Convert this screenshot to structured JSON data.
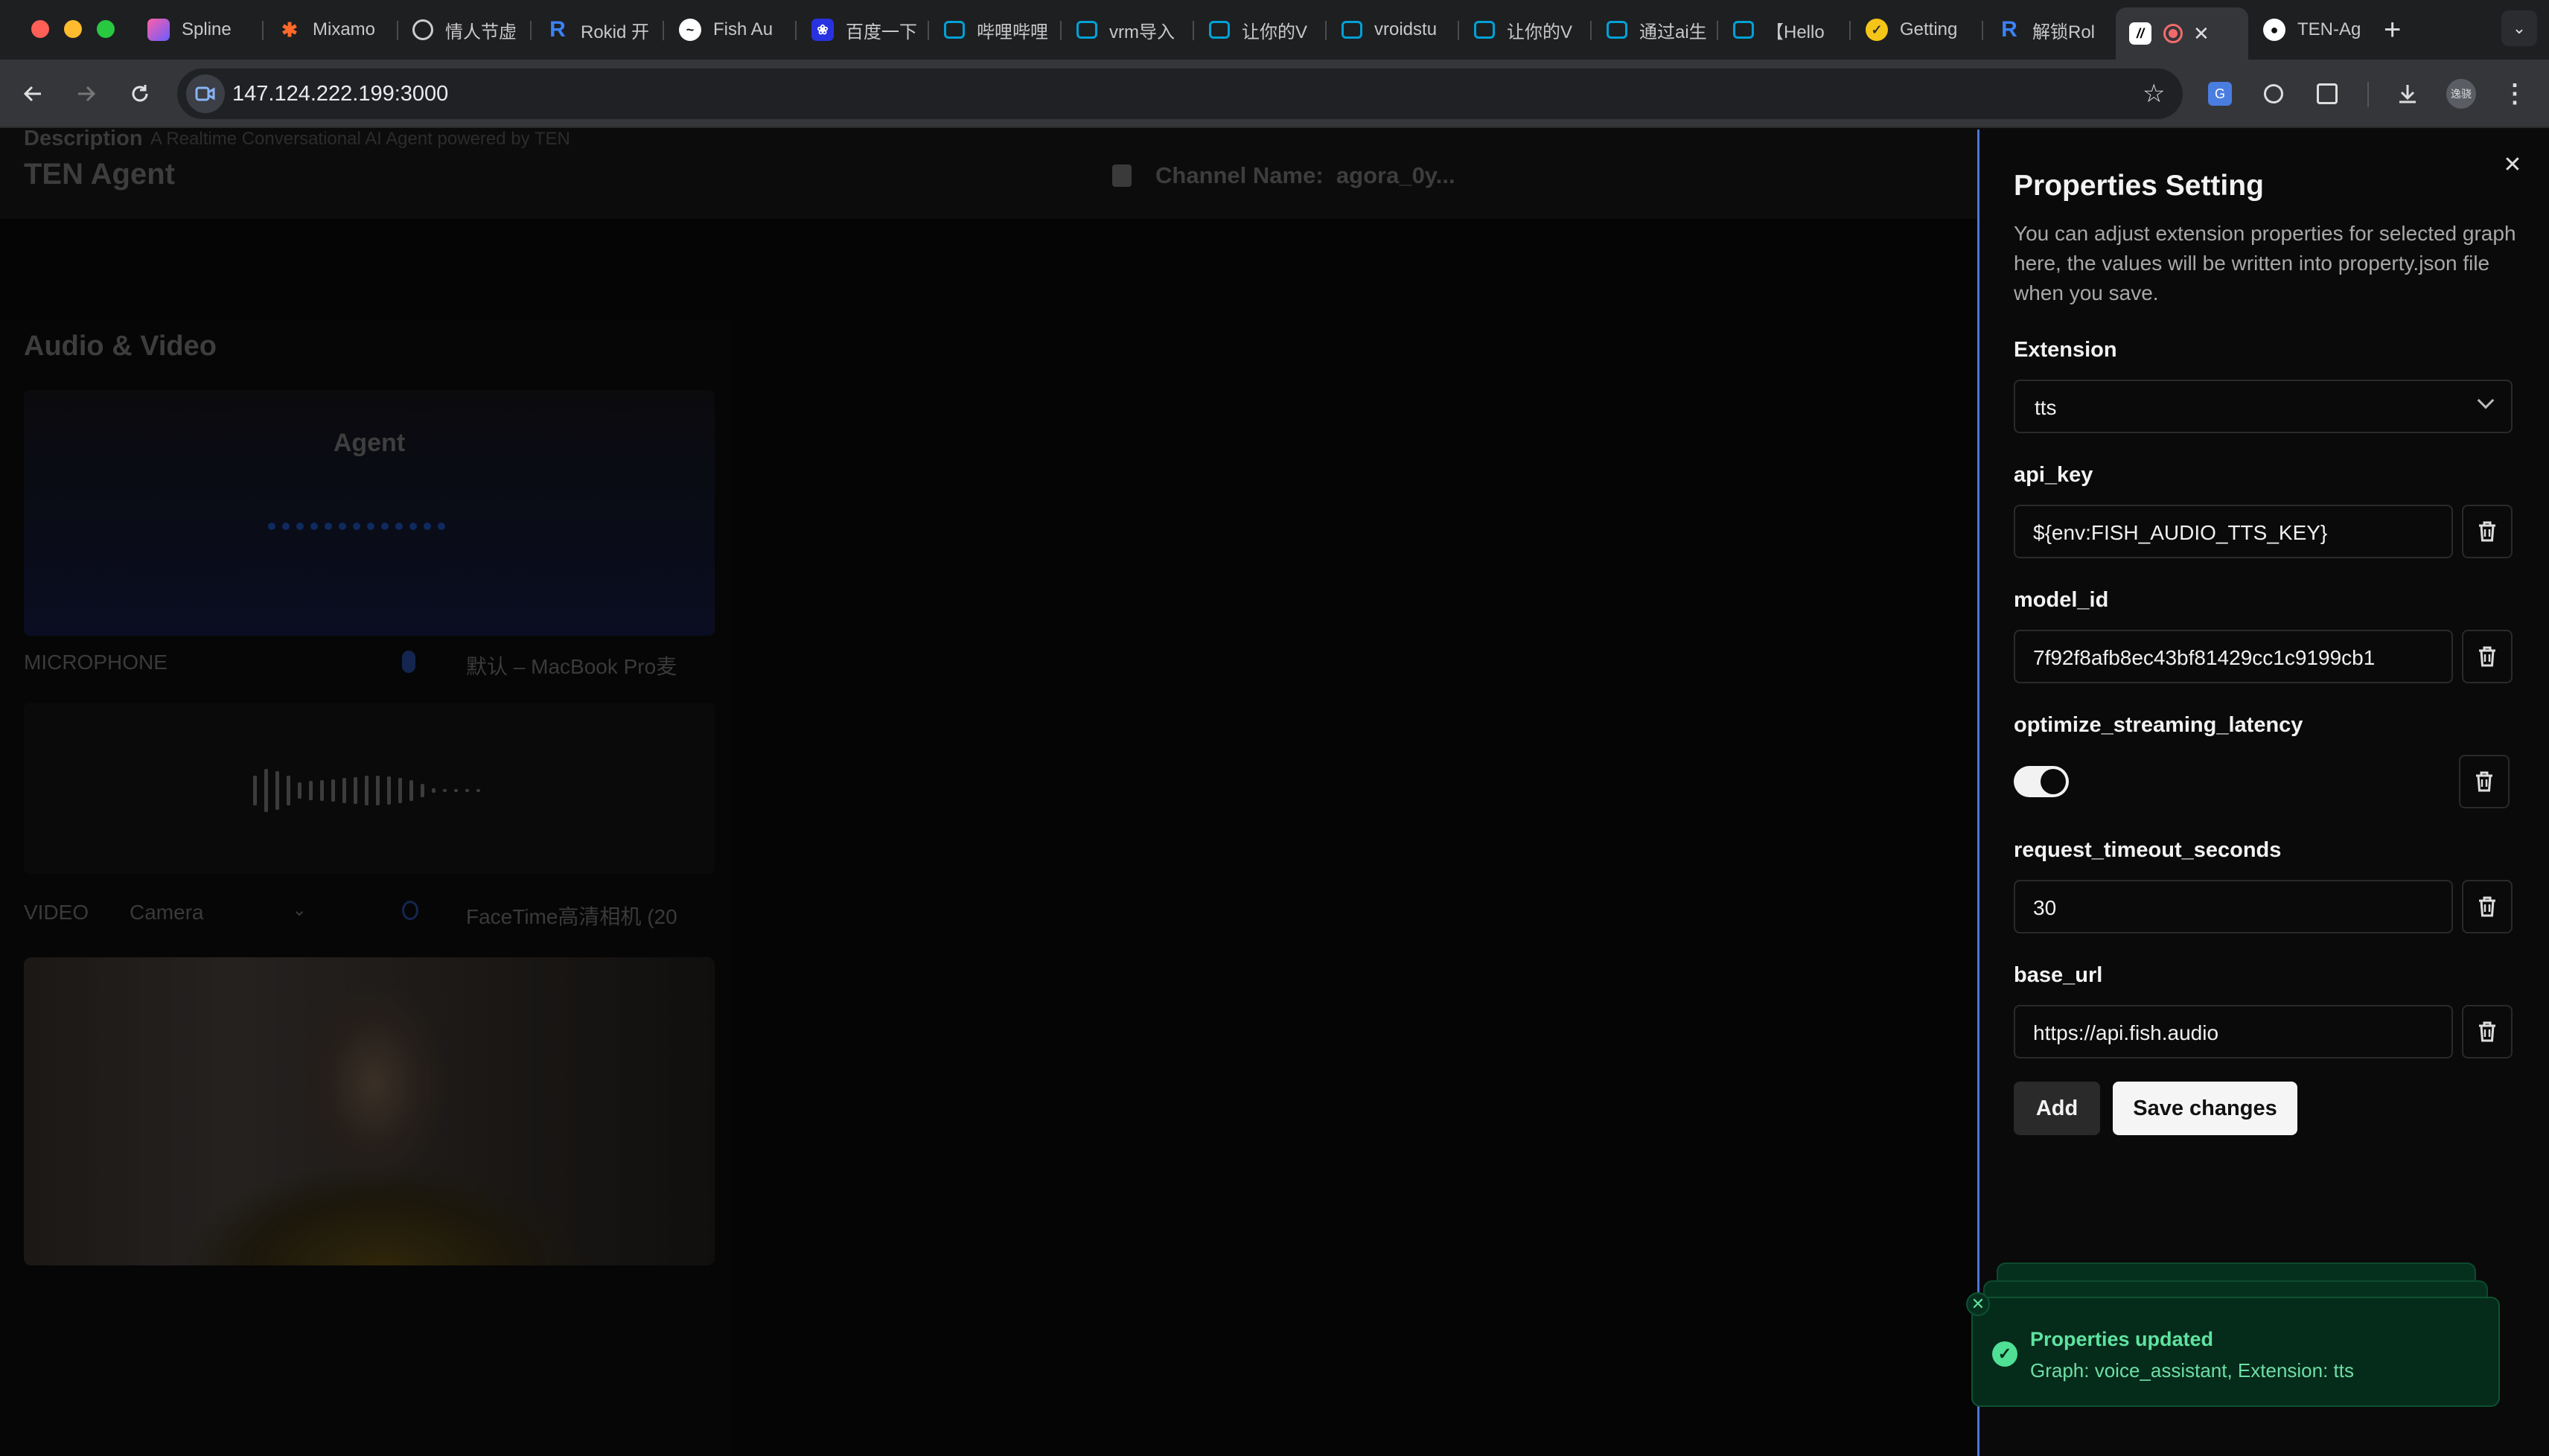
{
  "browser": {
    "tabs": [
      {
        "label": "Spline",
        "icon": "spline-icon",
        "color": "#7b5cff"
      },
      {
        "label": "Mixamo",
        "icon": "mixamo-icon",
        "color": "#ff6a2a"
      },
      {
        "label": "情人节虚",
        "icon": "openai-icon",
        "color": "#444444"
      },
      {
        "label": "Rokid 开",
        "icon": "rokid-icon",
        "color": "#3b82f6"
      },
      {
        "label": "Fish Au",
        "icon": "fish-audio-icon",
        "color": "#ffffff"
      },
      {
        "label": "百度一下",
        "icon": "baidu-icon",
        "color": "#2932e1"
      },
      {
        "label": "哔哩哔哩",
        "icon": "bilibili-icon",
        "color": "#00a1d6"
      },
      {
        "label": "vrm导入",
        "icon": "bilibili-icon",
        "color": "#00a1d6"
      },
      {
        "label": "让你的V",
        "icon": "bilibili-icon",
        "color": "#00a1d6"
      },
      {
        "label": "vroidstu",
        "icon": "bilibili-icon",
        "color": "#00a1d6"
      },
      {
        "label": "让你的V",
        "icon": "bilibili-icon",
        "color": "#00a1d6"
      },
      {
        "label": "通过ai生",
        "icon": "bilibili-icon",
        "color": "#00a1d6"
      },
      {
        "label": "【Hello",
        "icon": "bilibili-icon",
        "color": "#00a1d6"
      },
      {
        "label": "Getting",
        "icon": "getting-icon",
        "color": "#f5c518"
      },
      {
        "label": "解锁Rol",
        "icon": "rokid-icon",
        "color": "#3b82f6"
      },
      {
        "label": "",
        "icon": "ten-icon",
        "color": "#ffffff"
      },
      {
        "label": "TEN-Ag",
        "icon": "github-icon",
        "color": "#ffffff"
      }
    ],
    "url": "147.124.222.199:3000",
    "profile_badge": "逸骁"
  },
  "app": {
    "title": "TEN Agent",
    "channel_label": "Channel Name:",
    "channel_value": "agora_0y...",
    "description_label": "Description",
    "description_text": "A Realtime Conversational AI Agent powered by TEN",
    "av_title": "Audio & Video",
    "agent_label": "Agent",
    "mic_label": "MICROPHONE",
    "mic_device": "默认 – MacBook Pro麦",
    "video_label": "VIDEO",
    "video_source": "Camera",
    "camera_device": "FaceTime高清相机 (20"
  },
  "drawer": {
    "title": "Properties Setting",
    "description": "You can adjust extension properties for selected graph here, the values will be written into property.json file when you save.",
    "extension_label": "Extension",
    "extension_value": "tts",
    "fields": [
      {
        "name": "api_key",
        "value": "${env:FISH_AUDIO_TTS_KEY}"
      },
      {
        "name": "model_id",
        "value": "7f92f8afb8ec43bf81429cc1c9199cb1"
      },
      {
        "name": "optimize_streaming_latency",
        "value": true
      },
      {
        "name": "request_timeout_seconds",
        "value": "30"
      },
      {
        "name": "base_url",
        "value": "https://api.fish.audio"
      }
    ],
    "add_label": "Add",
    "save_label": "Save changes"
  },
  "toast": {
    "title": "Properties updated",
    "body": "Graph: voice_assistant, Extension: tts"
  },
  "colors": {
    "accent_border": "#4b77d9",
    "toast_green": "#5fe3a1"
  }
}
